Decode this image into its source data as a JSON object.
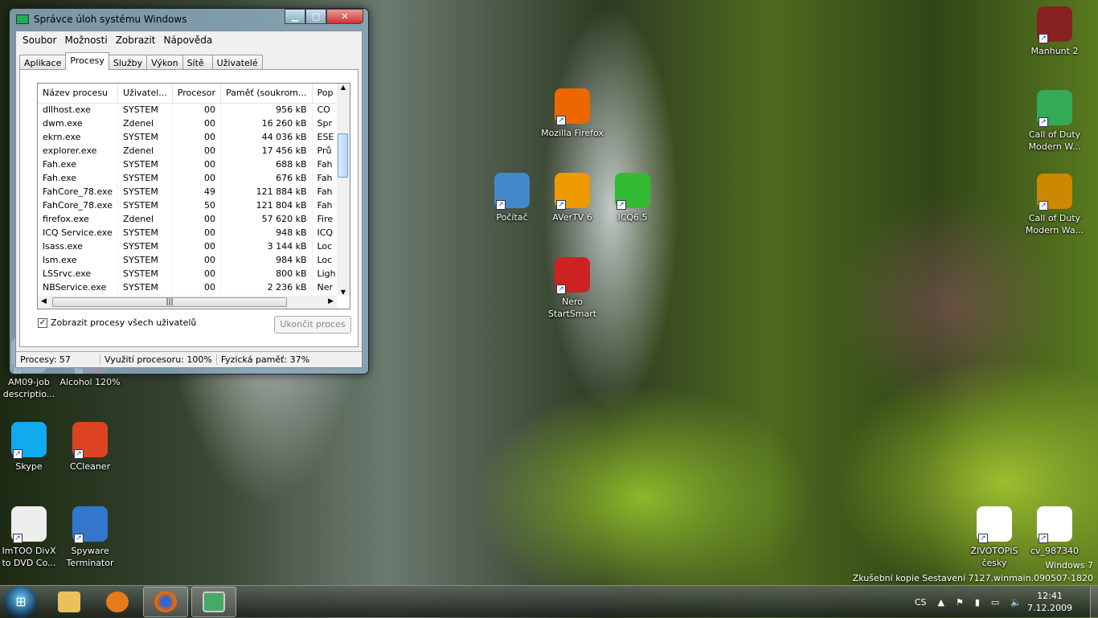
{
  "window": {
    "title": "Správce úloh systému Windows",
    "menu": [
      "Soubor",
      "Možnosti",
      "Zobrazit",
      "Nápověda"
    ],
    "tabs": [
      "Aplikace",
      "Procesy",
      "Služby",
      "Výkon",
      "Sítě",
      "Uživatelé"
    ],
    "active_tab": "Procesy",
    "columns": [
      "Název procesu",
      "Uživatel...",
      "Procesor",
      "Paměť (soukrom...",
      "Pop"
    ],
    "rows": [
      [
        "dllhost.exe",
        "SYSTEM",
        "00",
        "956 kB",
        "CO"
      ],
      [
        "dwm.exe",
        "Zdenel",
        "00",
        "16 260 kB",
        "Spr"
      ],
      [
        "ekrn.exe",
        "SYSTEM",
        "00",
        "44 036 kB",
        "ESE"
      ],
      [
        "explorer.exe",
        "Zdenel",
        "00",
        "17 456 kB",
        "Prů"
      ],
      [
        "Fah.exe",
        "SYSTEM",
        "00",
        "688 kB",
        "Fah"
      ],
      [
        "Fah.exe",
        "SYSTEM",
        "00",
        "676 kB",
        "Fah"
      ],
      [
        "FahCore_78.exe",
        "SYSTEM",
        "49",
        "121 884 kB",
        "Fah"
      ],
      [
        "FahCore_78.exe",
        "SYSTEM",
        "50",
        "121 804 kB",
        "Fah"
      ],
      [
        "firefox.exe",
        "Zdenel",
        "00",
        "57 620 kB",
        "Fire"
      ],
      [
        "ICQ Service.exe",
        "SYSTEM",
        "00",
        "948 kB",
        "ICQ"
      ],
      [
        "lsass.exe",
        "SYSTEM",
        "00",
        "3 144 kB",
        "Loc"
      ],
      [
        "lsm.exe",
        "SYSTEM",
        "00",
        "984 kB",
        "Loc"
      ],
      [
        "LSSrvc.exe",
        "SYSTEM",
        "00",
        "800 kB",
        "Ligh"
      ],
      [
        "NBService.exe",
        "SYSTEM",
        "00",
        "2 236 kB",
        "Ner"
      ]
    ],
    "show_all_label": "Zobrazit procesy všech uživatelů",
    "show_all_checked": true,
    "end_process": "Ukončit proces",
    "status": {
      "processes": "Procesy: 57",
      "cpu": "Využití procesoru: 100%",
      "memory": "Fyzická paměť: 37%"
    }
  },
  "desktop_icons": [
    {
      "label": "Manhunt 2",
      "color": "#822"
    },
    {
      "label": "Call of Duty Modern W...",
      "color": "#3a5"
    },
    {
      "label": "Call of Duty Modern Wa...",
      "color": "#c80"
    },
    {
      "label": "Mozilla Firefox",
      "color": "#e60"
    },
    {
      "label": "Počítač",
      "color": "#48c"
    },
    {
      "label": "AVerTV 6",
      "color": "#e90"
    },
    {
      "label": "ICQ6.5",
      "color": "#3b3"
    },
    {
      "label": "Nero StartSmart",
      "color": "#c22"
    },
    {
      "label": "AM09-job descriptio...",
      "color": "#ddd"
    },
    {
      "label": "Alcohol 120%",
      "color": "#c33"
    },
    {
      "label": "Skype",
      "color": "#1ae"
    },
    {
      "label": "CCleaner",
      "color": "#d42"
    },
    {
      "label": "ImTOO DivX to DVD Co...",
      "color": "#eee"
    },
    {
      "label": "Spyware Terminator",
      "color": "#37c"
    },
    {
      "label": "ŽIVOTOPIS česky",
      "color": "#fff"
    },
    {
      "label": "cv_987340",
      "color": "#fff"
    }
  ],
  "watermark": {
    "line1": "Windows 7",
    "line2": "Zkušební kopie Sestavení 7127.winmain.090507-1820"
  },
  "tray": {
    "lang": "CS",
    "time": "12:41",
    "date": "7.12.2009"
  }
}
